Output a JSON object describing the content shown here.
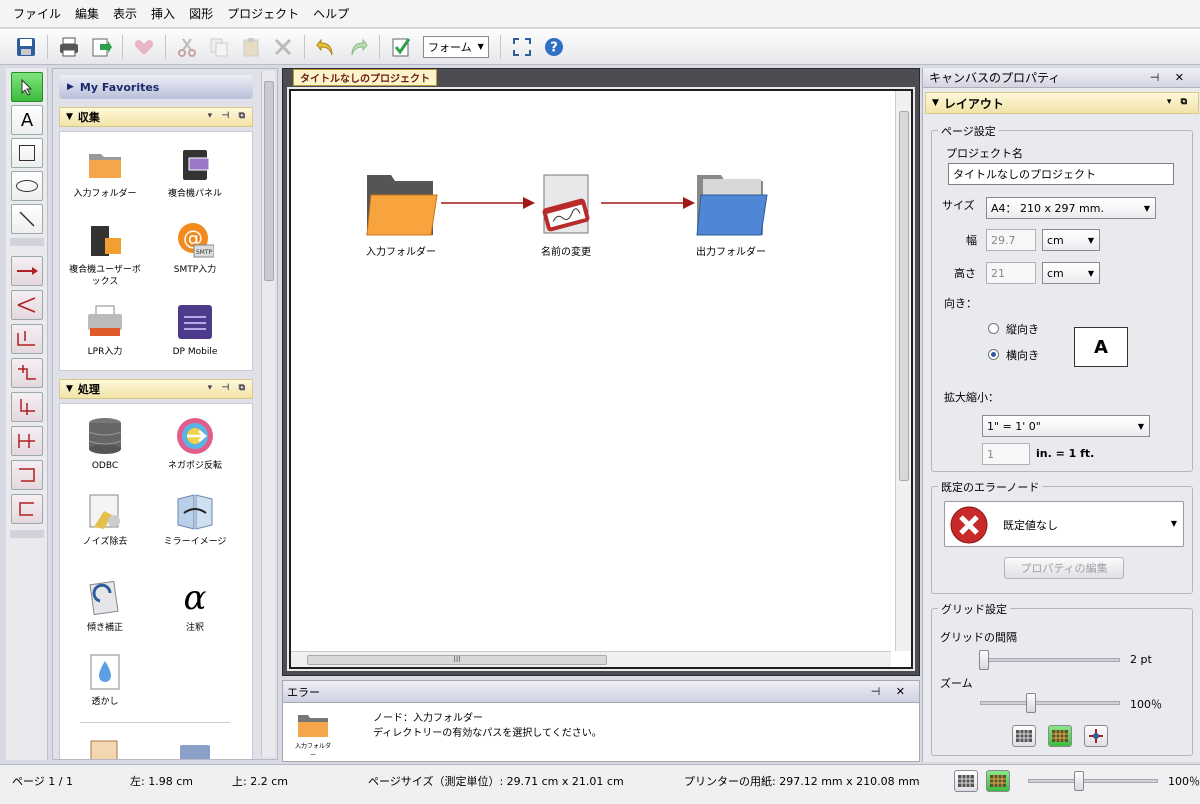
{
  "menu": [
    "ファイル",
    "編集",
    "表示",
    "挿入",
    "図形",
    "プロジェクト",
    "ヘルプ"
  ],
  "toolbar": {
    "form_select": "フォーム"
  },
  "palette": {
    "favorites": "My Favorites",
    "collect": {
      "title": "収集",
      "items": [
        "入力フォルダー",
        "複合機パネル",
        "複合機ユーザーボックス",
        "SMTP入力",
        "LPR入力",
        "DP Mobile"
      ]
    },
    "process": {
      "title": "処理",
      "items": [
        "ODBC",
        "ネガポジ反転",
        "ノイズ除去",
        "ミラーイメージ",
        "傾き補正",
        "注釈",
        "透かし"
      ]
    }
  },
  "canvas": {
    "project_tab": "タイトルなしのプロジェクト",
    "nodes": [
      "入力フォルダー",
      "名前の変更",
      "出力フォルダー"
    ]
  },
  "errors": {
    "title": "エラー",
    "node_label": "入力フォルダー",
    "node_line": "ノード：入力フォルダー",
    "message": "ディレクトリーの有効なパスを選択してください。"
  },
  "props": {
    "title": "キャンバスのプロパティ",
    "layout": "レイアウト",
    "page_settings": "ページ設定",
    "project_name_label": "プロジェクト名",
    "project_name": "タイトルなしのプロジェクト",
    "size_label": "サイズ",
    "size_value": "A4：  210 x 297 mm.",
    "width_label": "幅",
    "width_value": "29.7",
    "width_unit": "cm",
    "height_label": "高さ",
    "height_value": "21",
    "height_unit": "cm",
    "orientation_label": "向き：",
    "portrait": "縦向き",
    "landscape": "横向き",
    "orientation_preview": "A",
    "scale_label": "拡大縮小：",
    "scale_value": "1\" = 1' 0\"",
    "scale_input": "1",
    "scale_suffix": "in.  =  1 ft.",
    "error_node_group": "既定のエラーノード",
    "error_node_value": "既定値なし",
    "edit_props_button": "プロパティの編集",
    "grid_group": "グリッド設定",
    "grid_spacing_label": "グリッドの間隔",
    "grid_spacing_value": "2 pt",
    "zoom_label": "ズーム",
    "zoom_value": "100％"
  },
  "status": {
    "page": "ページ 1 / 1",
    "left": "左:  1.98 cm",
    "top": "上:  2.2 cm",
    "page_size": "ページサイズ（測定単位）: 29.71 cm x 21.01 cm",
    "printer_paper": "プリンターの用紙:  297.12 mm x 210.08 mm",
    "zoom": "100％"
  }
}
